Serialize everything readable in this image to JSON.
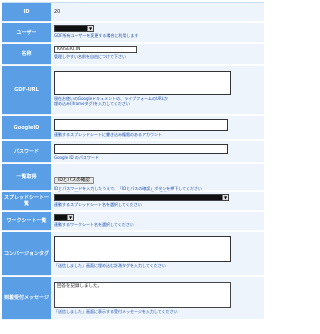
{
  "rows": {
    "id": {
      "label": "ID",
      "value": "20"
    },
    "user": {
      "label": "ユーザー",
      "help": "GDF所有ユーザーを変更する場合に利用します"
    },
    "name": {
      "label": "名称",
      "value": "KAISEKI.IN",
      "help": "管理しやすい名前を自由につけて下さい"
    },
    "url": {
      "label": "GDF-URL",
      "help": "現在お使いのGoogleドキュメントの、ライブフォームのURLか\n埋め込み(iframeタグ)を入力してください"
    },
    "googleid": {
      "label": "GoogleID",
      "help": "連動するスプレッドシートに書き込み権限のあるアカウント"
    },
    "password": {
      "label": "パスワード",
      "help": "Google ID のパスワード"
    },
    "list": {
      "label": "一覧取得",
      "button": "IDとパスの確認",
      "help": "IDとパスワードを入力したうえで、「IDとパスの確認」ボタンを押下してください\n　取り扱い可能なスプレッドシート/ワークシートを一覧に表示します"
    },
    "spreadsheet": {
      "label": "スプレッドシート一覧",
      "help": "連動するスプレッドシート名を選択してください"
    },
    "worksheet": {
      "label": "ワークシート一覧",
      "help": "連動するワークシート名を選択してください"
    },
    "conversion": {
      "label": "コンバージョンタグ",
      "help": "「送信しました」画面に埋め込む計測タグを入力してください"
    },
    "message": {
      "label": "到着受付メッセージ",
      "value": "回答を記録しました。",
      "help": "「送信しました」画面に表示する受付メッセージを入力してください"
    }
  }
}
